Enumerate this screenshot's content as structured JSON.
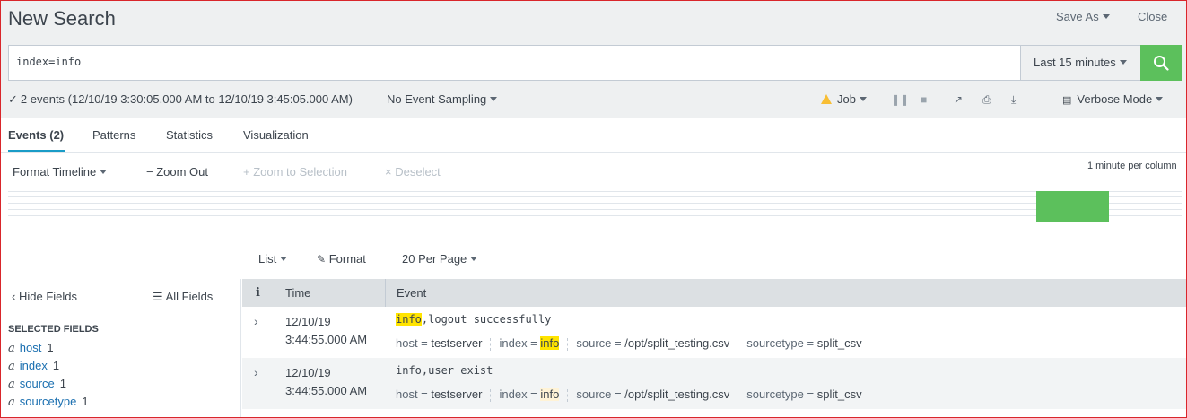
{
  "header": {
    "title": "New Search",
    "save_as": "Save As",
    "close": "Close"
  },
  "search": {
    "query": "index=info",
    "time_range": "Last 15 minutes"
  },
  "status": {
    "events": "2 events (12/10/19 3:30:05.000 AM to 12/10/19 3:45:05.000 AM)",
    "sampling": "No Event Sampling",
    "job": "Job",
    "mode": "Verbose Mode"
  },
  "tabs": [
    "Events (2)",
    "Patterns",
    "Statistics",
    "Visualization"
  ],
  "timeline": {
    "format": "Format Timeline",
    "zoom_out": "Zoom Out",
    "zoom_selection": "Zoom to Selection",
    "deselect": "Deselect",
    "scale": "1 minute per column"
  },
  "results_toolbar": {
    "list": "List",
    "format": "Format",
    "per_page": "20 Per Page"
  },
  "sidebar": {
    "hide_fields": "Hide Fields",
    "all_fields": "All Fields",
    "selected_heading": "SELECTED FIELDS",
    "fields": [
      {
        "type": "a",
        "name": "host",
        "count": "1"
      },
      {
        "type": "a",
        "name": "index",
        "count": "1"
      },
      {
        "type": "a",
        "name": "source",
        "count": "1"
      },
      {
        "type": "a",
        "name": "sourcetype",
        "count": "1"
      }
    ]
  },
  "table": {
    "col_info": "i",
    "col_time": "Time",
    "col_event": "Event",
    "rows": [
      {
        "date": "12/10/19",
        "time": "3:44:55.000 AM",
        "event_hl": "info",
        "event_rest": ",logout successfully",
        "host": "testserver",
        "index": "info",
        "source": "/opt/split_testing.csv",
        "sourcetype": "split_csv"
      },
      {
        "date": "12/10/19",
        "time": "3:44:55.000 AM",
        "event_hl": "",
        "event_rest": "info,user exist",
        "host": "testserver",
        "index": "info",
        "source": "/opt/split_testing.csv",
        "sourcetype": "split_csv"
      }
    ]
  },
  "colors": {
    "accent": "#5cc05c",
    "highlight": "#ffe400",
    "link": "#1a6fb0",
    "tab_underline": "#1a9cc7"
  }
}
